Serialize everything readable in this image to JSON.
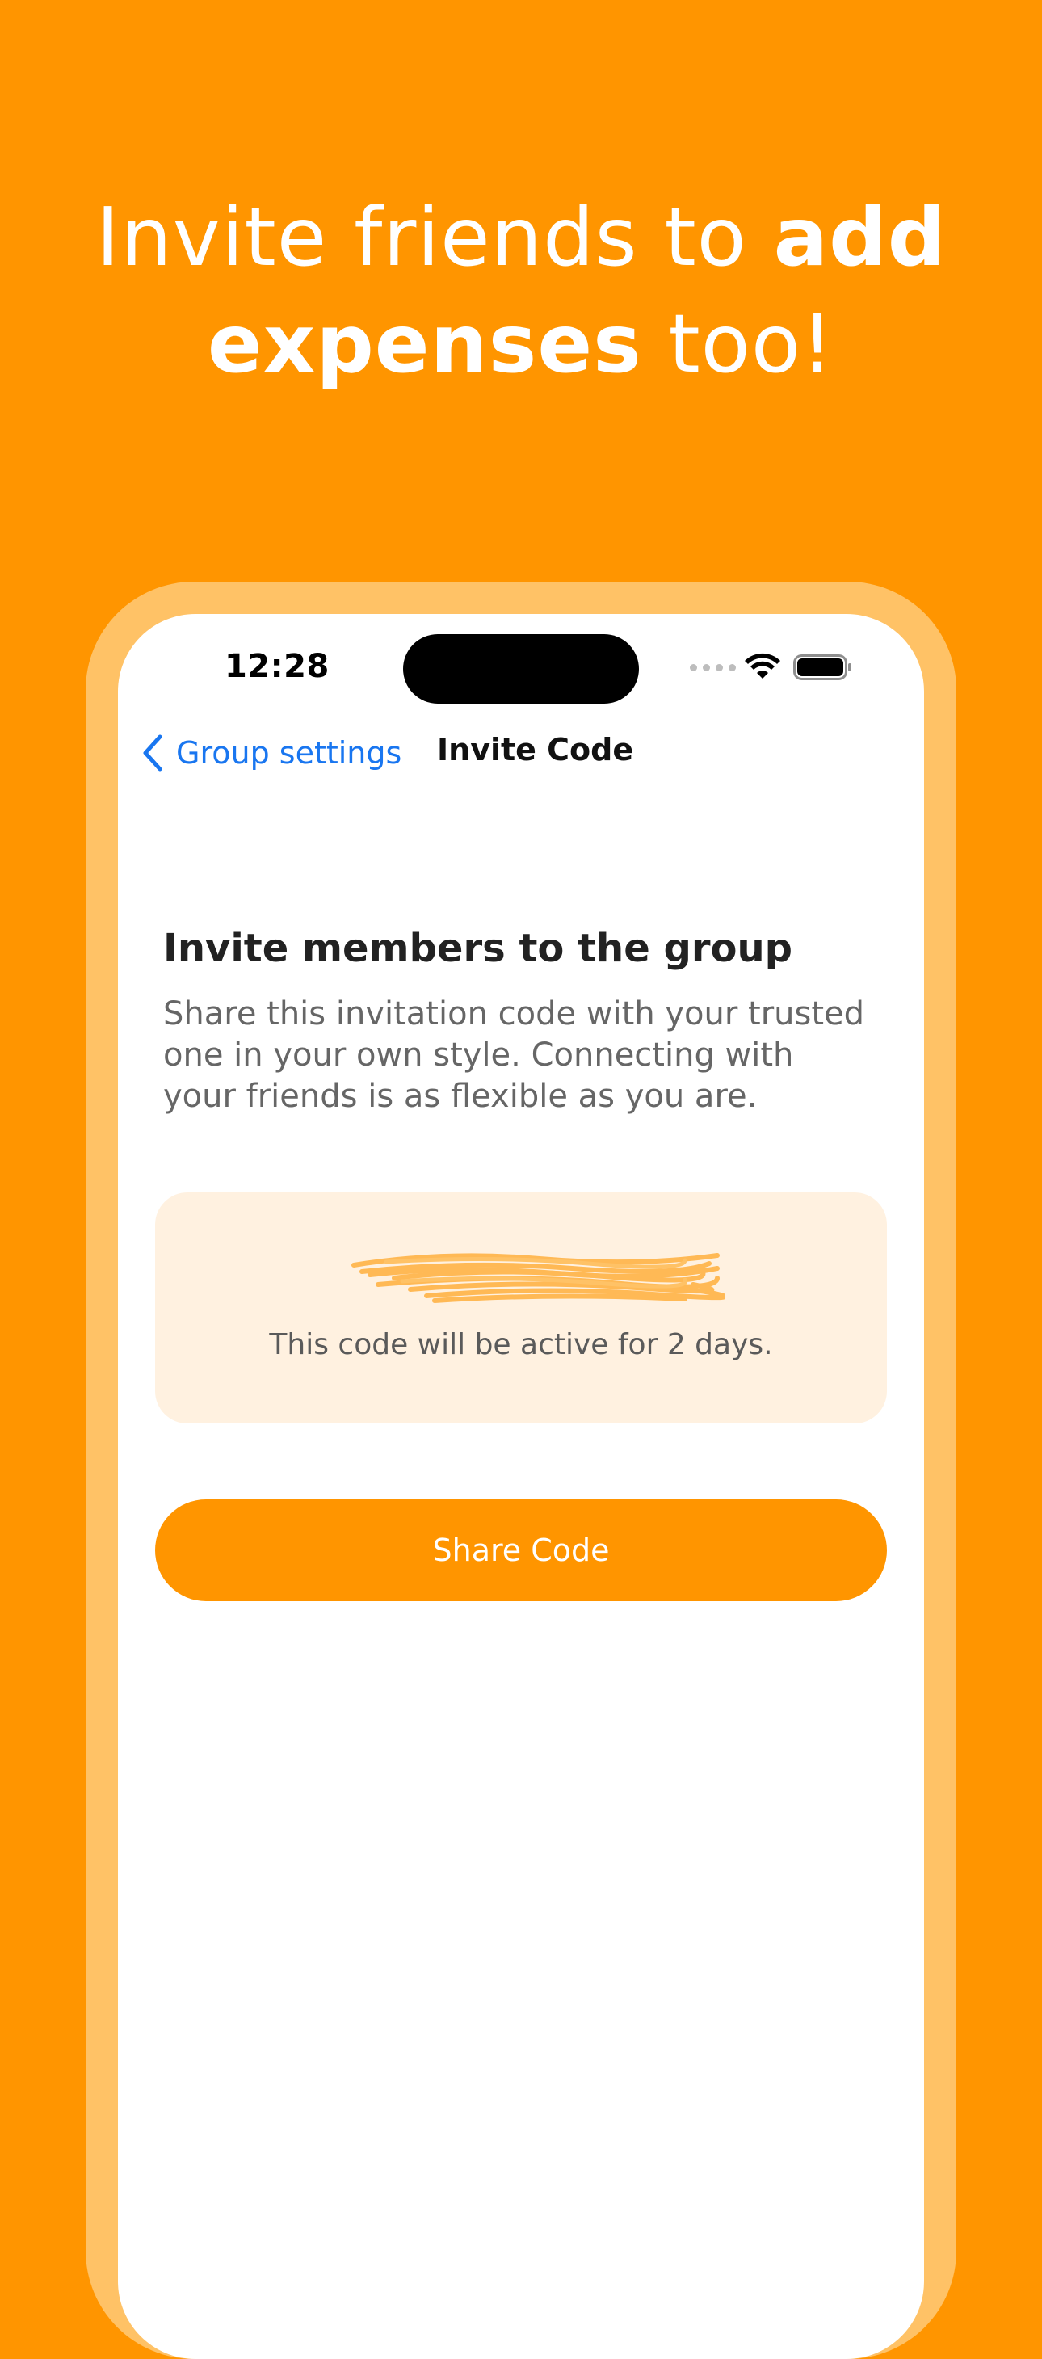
{
  "headline": {
    "part1": "Invite friends to ",
    "bold1": "add",
    "bold2": "expenses",
    "part2": " too!"
  },
  "status_bar": {
    "time": "12:28",
    "icons": [
      "signal-dots-icon",
      "wifi-icon",
      "battery-icon"
    ]
  },
  "nav": {
    "back_label": "Group settings",
    "title": "Invite Code"
  },
  "invite": {
    "title": "Invite members to the group",
    "description": "Share this invitation code with your trusted one in your own style. Connecting with your friends is as flexible as you are.",
    "active_note": "This code will be active for 2 days."
  },
  "share_button": {
    "label": "Share Code"
  },
  "colors": {
    "background": "#FF9500",
    "frame": "#FFC266",
    "accent": "#FF9500",
    "link": "#1976F0",
    "card": "#FFF1E0"
  }
}
